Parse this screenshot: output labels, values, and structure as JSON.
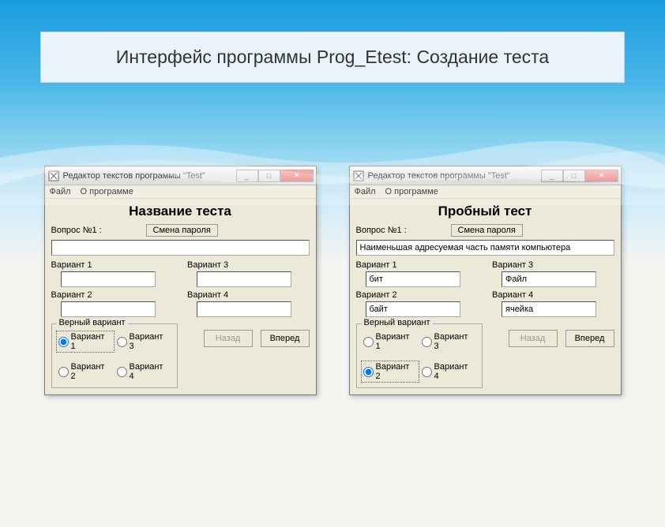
{
  "slide_title": "Интерфейс программы Prog_Etest: Создание теста",
  "window_left": {
    "titlebar": "Редактор текстов программы \"Test\"",
    "menu": {
      "file": "Файл",
      "about": "О программе"
    },
    "test_title": "Название теста",
    "question_label": "Вопрос №1 :",
    "change_password": "Смена пароля",
    "question_value": "",
    "variants": {
      "v1_label": "Вариант 1",
      "v1_value": "",
      "v2_label": "Вариант 2",
      "v2_value": "",
      "v3_label": "Вариант 3",
      "v3_value": "",
      "v4_label": "Вариант 4",
      "v4_value": ""
    },
    "correct": {
      "legend": "Верный вариант",
      "r1": "Вариант 1",
      "r2": "Вариант 2",
      "r3": "Вариант 3",
      "r4": "Вариант 4",
      "selected": 1
    },
    "nav": {
      "back": "Назад",
      "forward": "Вперед",
      "back_disabled": true
    }
  },
  "window_right": {
    "titlebar": "Редактор текстов программы \"Test\"",
    "menu": {
      "file": "Файл",
      "about": "О программе"
    },
    "test_title": "Пробный тест",
    "question_label": "Вопрос №1 :",
    "change_password": "Смена пароля",
    "question_value": "Наименьшая адресуемая часть памяти компьютера",
    "variants": {
      "v1_label": "Вариант 1",
      "v1_value": "бит",
      "v2_label": "Вариант 2",
      "v2_value": "байт",
      "v3_label": "Вариант 3",
      "v3_value": "Файл",
      "v4_label": "Вариант 4",
      "v4_value": "ячейка"
    },
    "correct": {
      "legend": "Верный вариант",
      "r1": "Вариант 1",
      "r2": "Вариант 2",
      "r3": "Вариант 3",
      "r4": "Вариант 4",
      "selected": 2
    },
    "nav": {
      "back": "Назад",
      "forward": "Вперед",
      "back_disabled": true
    }
  }
}
